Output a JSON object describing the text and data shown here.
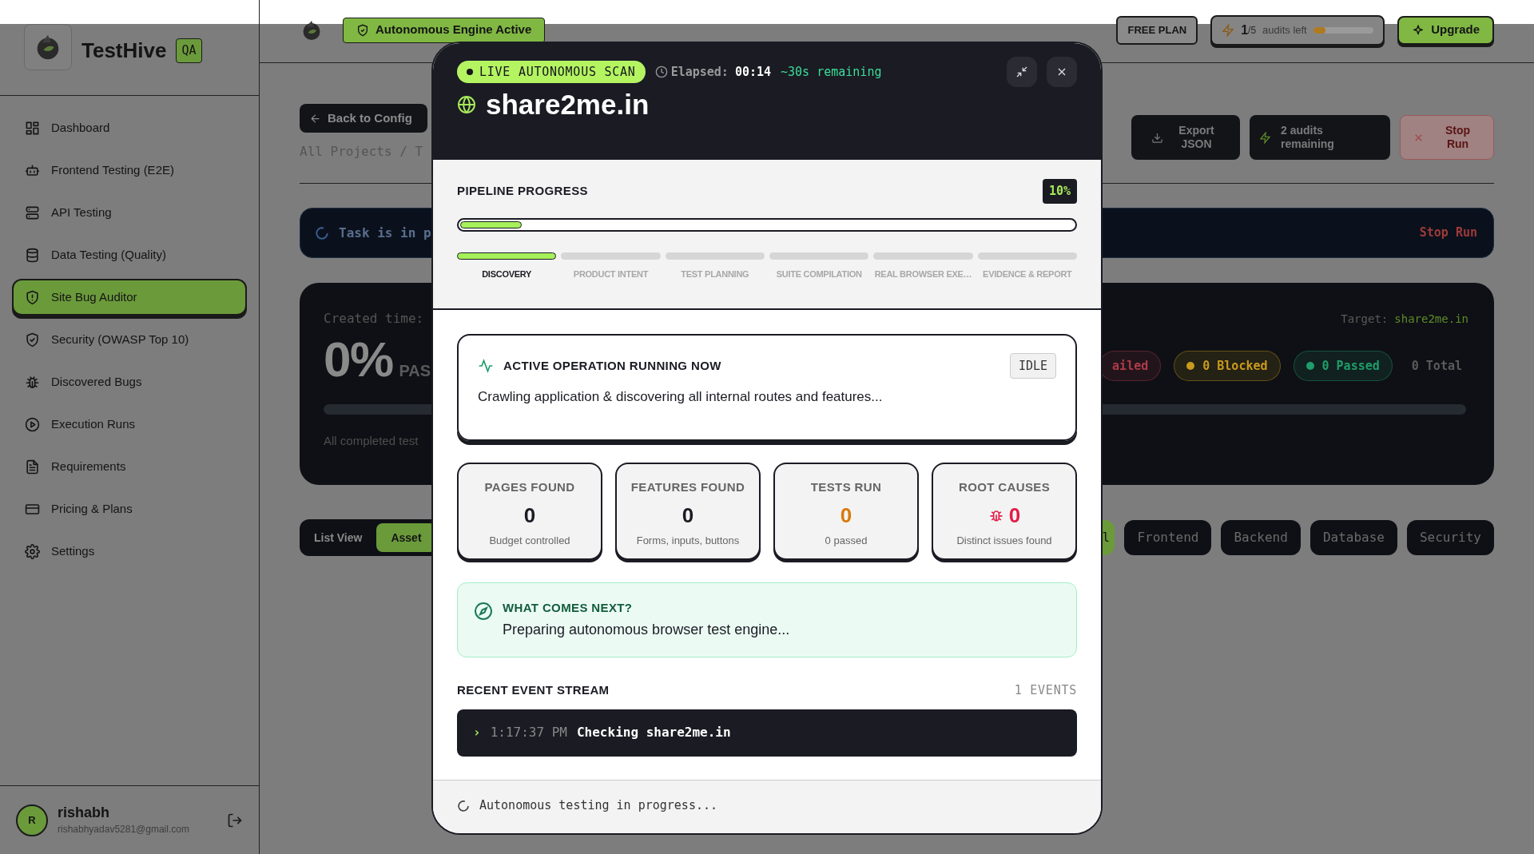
{
  "sidebar": {
    "brand": "TestHive",
    "badge": "QA",
    "items": [
      {
        "label": "Dashboard",
        "selected": false
      },
      {
        "label": "Frontend Testing (E2E)",
        "selected": false
      },
      {
        "label": "API Testing",
        "selected": false
      },
      {
        "label": "Data Testing (Quality)",
        "selected": false
      },
      {
        "label": "Site Bug Auditor",
        "selected": true
      },
      {
        "label": "Security (OWASP Top 10)",
        "selected": false
      },
      {
        "label": "Discovered Bugs",
        "selected": false
      },
      {
        "label": "Execution Runs",
        "selected": false
      },
      {
        "label": "Requirements",
        "selected": false
      },
      {
        "label": "Pricing & Plans",
        "selected": false
      },
      {
        "label": "Settings",
        "selected": false
      }
    ],
    "user": {
      "initial": "R",
      "name": "rishabh",
      "email": "rishabhyadav5281@gmail.com"
    }
  },
  "header": {
    "engine_badge": "Autonomous Engine Active",
    "plan": "FREE PLAN",
    "audits": {
      "used": "1",
      "total": "/5",
      "label": "audits left",
      "level": 0.2
    },
    "upgrade": "Upgrade"
  },
  "toolbar": {
    "back": "Back to Config",
    "breadcrumb": "All Projects / T",
    "actions": [
      {
        "label": "Export JSON",
        "kind": "export"
      },
      {
        "label": "2 audits remaining",
        "kind": "audits"
      },
      {
        "label": "Stop Run",
        "kind": "stop"
      }
    ]
  },
  "task_banner": {
    "text": "Task is in p",
    "action": "Stop Run"
  },
  "summary": {
    "created_label": "Created time:",
    "percent": "0%",
    "pass_label": "PAS",
    "level": 0,
    "footnote": "All completed test",
    "target_label": "Target:",
    "target": "share2me.in",
    "pills": [
      {
        "label": "ailed",
        "color": "#b03a4a",
        "dot": false
      },
      {
        "label": "0 Blocked",
        "color": "#c99a1c",
        "dot": true
      },
      {
        "label": "0 Passed",
        "color": "#1f9d6a",
        "dot": true
      }
    ],
    "total": "0 Total"
  },
  "view_tabs": [
    {
      "label": "List View",
      "selected": false
    },
    {
      "label": "Asset",
      "selected": true
    }
  ],
  "filter_tabs": [
    {
      "label": "l",
      "selected": true
    },
    {
      "label": "Frontend",
      "selected": false
    },
    {
      "label": "Backend",
      "selected": false
    },
    {
      "label": "Database",
      "selected": false
    },
    {
      "label": "Security",
      "selected": false
    }
  ],
  "modal": {
    "live_badge": "LIVE AUTONOMOUS SCAN",
    "elapsed_label": "Elapsed:",
    "elapsed": "00:14",
    "remaining": "~30s remaining",
    "title": "share2me.in",
    "pipeline": {
      "title": "PIPELINE PROGRESS",
      "percent": "10%",
      "level": 0.1,
      "steps": [
        {
          "label": "DISCOVERY",
          "selected": true
        },
        {
          "label": "PRODUCT INTENT",
          "selected": false
        },
        {
          "label": "TEST PLANNING",
          "selected": false
        },
        {
          "label": "SUITE COMPILATION",
          "selected": false
        },
        {
          "label": "REAL BROWSER EXE…",
          "selected": false
        },
        {
          "label": "EVIDENCE & REPORT",
          "selected": false
        }
      ]
    },
    "operation": {
      "title": "ACTIVE OPERATION RUNNING NOW",
      "status": "IDLE",
      "text": "Crawling application & discovering all internal routes and features..."
    },
    "stats": [
      {
        "label": "PAGES FOUND",
        "value": "0",
        "note": "Budget controlled",
        "kind": "plain"
      },
      {
        "label": "FEATURES FOUND",
        "value": "0",
        "note": "Forms, inputs, buttons",
        "kind": "plain"
      },
      {
        "label": "TESTS RUN",
        "value": "0",
        "note": "0 passed",
        "kind": "warning"
      },
      {
        "label": "ROOT CAUSES",
        "value": "0",
        "note": "Distinct issues found",
        "kind": "issue"
      }
    ],
    "next": {
      "title": "WHAT COMES NEXT?",
      "text": "Preparing autonomous browser test engine..."
    },
    "events": {
      "title": "RECENT EVENT STREAM",
      "count": "1 EVENTS",
      "items": [
        {
          "marker": "›",
          "time": "1:17:37 PM",
          "text": "Checking share2me.in"
        }
      ]
    },
    "footer": "Autonomous testing in progress..."
  }
}
